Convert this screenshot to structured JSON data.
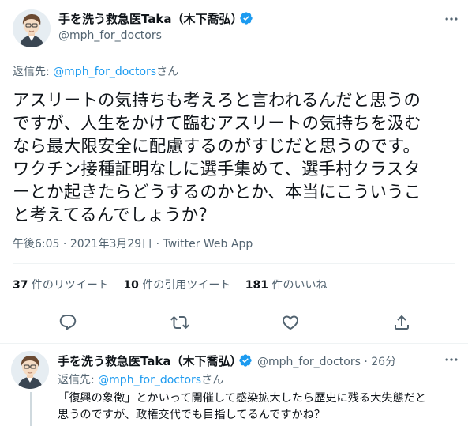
{
  "tweet": {
    "display_name": "手を洗う救急医Taka（木下喬弘）",
    "handle": "@mph_for_doctors",
    "reply_prefix": "返信先: ",
    "reply_handle": "@mph_for_doctors",
    "reply_suffix": "さん",
    "body_lines": [
      "アスリートの気持ちも考えろと言われるんだと思うの",
      "ですが、人生をかけて臨むアスリートの気持ちを汲む",
      "なら最大限安全に配慮するのがすじだと思うのです。",
      "ワクチン接種証明なしに選手集めて、選手村クラスタ",
      "ーとか起きたらどうするのかとか、本当にこういうこ",
      "と考えてるんでしょうか？"
    ],
    "time": "午後6:05",
    "date": "2021年3月29日",
    "source": "Twitter Web App",
    "separator": " · "
  },
  "stats": {
    "retweets_count": "37",
    "retweets_label": " 件のリツイート",
    "quotes_count": "10",
    "quotes_label": " 件の引用ツイート",
    "likes_count": "181",
    "likes_label": " 件のいいね"
  },
  "actions": [
    "reply-icon",
    "retweet-icon",
    "like-icon",
    "share-icon"
  ],
  "reply": {
    "display_name": "手を洗う救急医Taka（木下喬弘）",
    "handle": "@mph_for_doctors",
    "time": "· 26分",
    "reply_prefix": "返信先: ",
    "reply_handle": "@mph_for_doctors",
    "reply_suffix": "さん",
    "body_lines": [
      "「復興の象徴」とかいって開催して感染拡大したら歴史に残る大失態だと",
      "思うのですが、政権交代でも目指してるんですかね？"
    ]
  },
  "colors": {
    "accent": "#1d9bf0",
    "secondary_text": "#536471",
    "verified": "#1d9bf0"
  }
}
